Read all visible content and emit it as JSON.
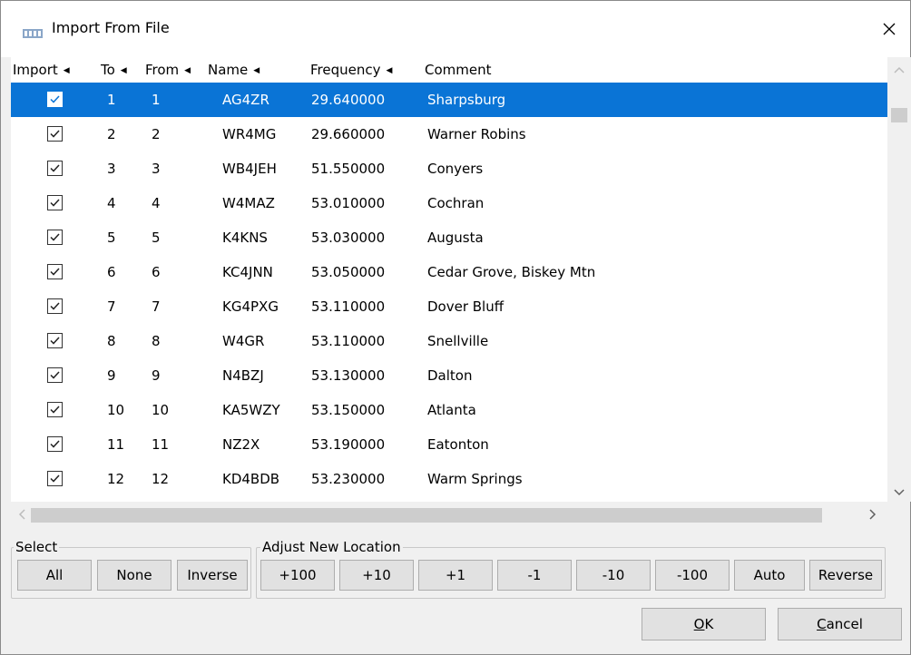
{
  "window": {
    "title": "Import From File"
  },
  "columns": [
    {
      "label": "Import",
      "sorted": true
    },
    {
      "label": "To",
      "sorted": true
    },
    {
      "label": "From",
      "sorted": true
    },
    {
      "label": "Name",
      "sorted": true
    },
    {
      "label": "Frequency",
      "sorted": true
    },
    {
      "label": "Comment",
      "sorted": false
    }
  ],
  "rows": [
    {
      "checked": true,
      "to": "1",
      "from": "1",
      "name": "AG4ZR",
      "frequency": "29.640000",
      "comment": "Sharpsburg",
      "selected": true
    },
    {
      "checked": true,
      "to": "2",
      "from": "2",
      "name": "WR4MG",
      "frequency": "29.660000",
      "comment": "Warner Robins"
    },
    {
      "checked": true,
      "to": "3",
      "from": "3",
      "name": "WB4JEH",
      "frequency": "51.550000",
      "comment": "Conyers"
    },
    {
      "checked": true,
      "to": "4",
      "from": "4",
      "name": "W4MAZ",
      "frequency": "53.010000",
      "comment": "Cochran"
    },
    {
      "checked": true,
      "to": "5",
      "from": "5",
      "name": "K4KNS",
      "frequency": "53.030000",
      "comment": "Augusta"
    },
    {
      "checked": true,
      "to": "6",
      "from": "6",
      "name": "KC4JNN",
      "frequency": "53.050000",
      "comment": "Cedar Grove, Biskey Mtn"
    },
    {
      "checked": true,
      "to": "7",
      "from": "7",
      "name": "KG4PXG",
      "frequency": "53.110000",
      "comment": "Dover Bluff"
    },
    {
      "checked": true,
      "to": "8",
      "from": "8",
      "name": "W4GR",
      "frequency": "53.110000",
      "comment": "Snellville"
    },
    {
      "checked": true,
      "to": "9",
      "from": "9",
      "name": "N4BZJ",
      "frequency": "53.130000",
      "comment": "Dalton"
    },
    {
      "checked": true,
      "to": "10",
      "from": "10",
      "name": "KA5WZY",
      "frequency": "53.150000",
      "comment": "Atlanta"
    },
    {
      "checked": true,
      "to": "11",
      "from": "11",
      "name": "NZ2X",
      "frequency": "53.190000",
      "comment": "Eatonton"
    },
    {
      "checked": true,
      "to": "12",
      "from": "12",
      "name": "KD4BDB",
      "frequency": "53.230000",
      "comment": "Warm Springs"
    }
  ],
  "select_group": {
    "label": "Select",
    "buttons": [
      "All",
      "None",
      "Inverse"
    ]
  },
  "adjust_group": {
    "label": "Adjust New Location",
    "buttons": [
      "+100",
      "+10",
      "+1",
      "-1",
      "-10",
      "-100",
      "Auto",
      "Reverse"
    ]
  },
  "footer": {
    "ok": {
      "accel": "O",
      "rest": "K"
    },
    "cancel": {
      "accel": "C",
      "rest": "ancel"
    }
  },
  "colors": {
    "selection": "#0a74d6",
    "window_bg": "#f0f0f0",
    "button_bg": "#e1e1e1"
  },
  "icons": {
    "close": "close-icon",
    "app": "app-icon",
    "sort": "sort-arrow-icon"
  }
}
